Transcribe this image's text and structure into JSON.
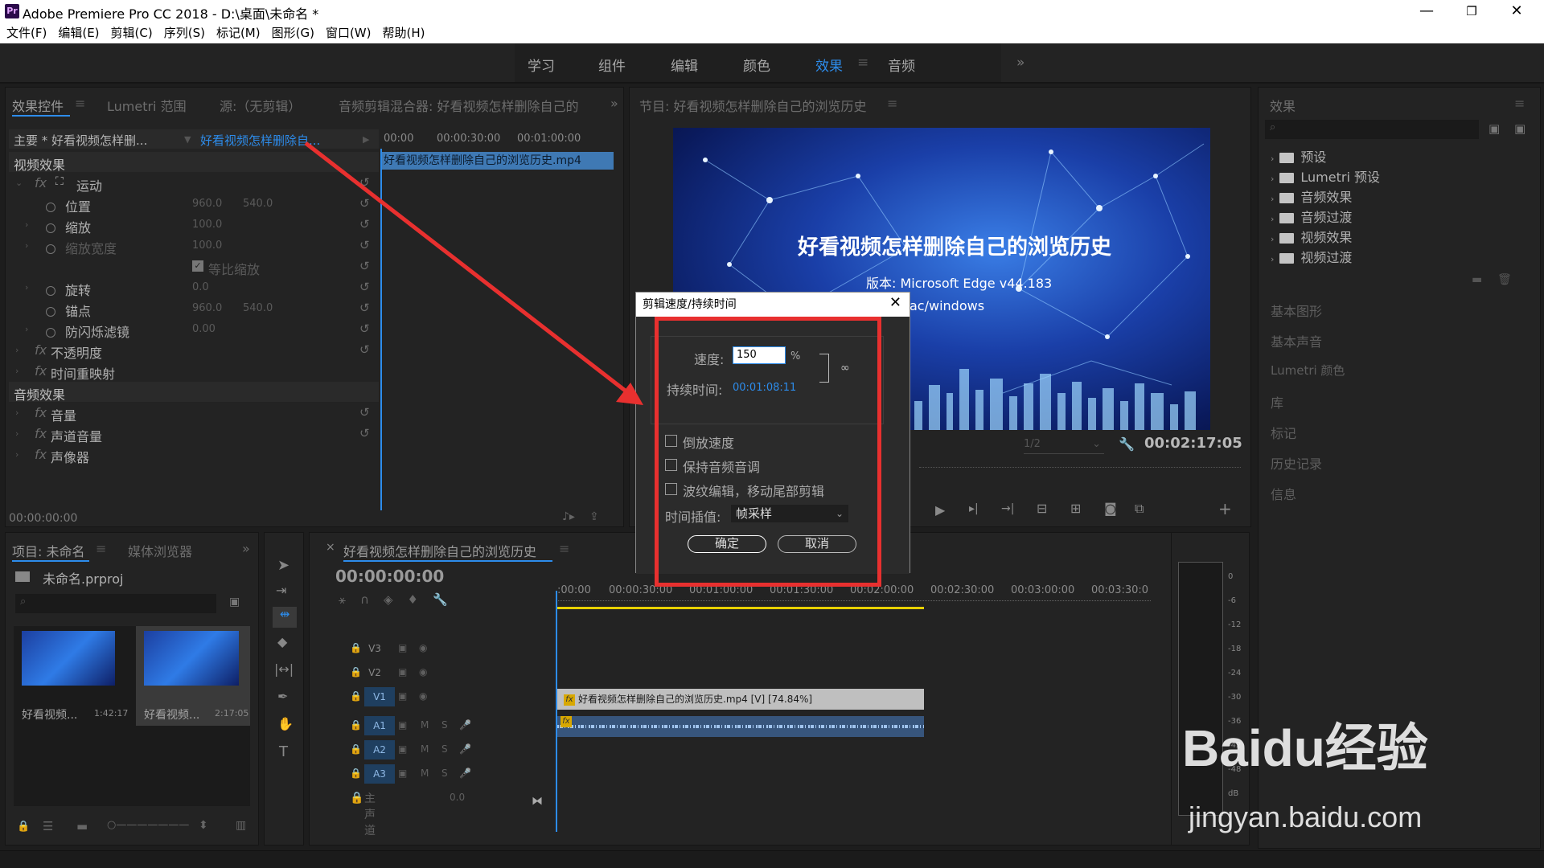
{
  "app": {
    "title": "Adobe Premiere Pro CC 2018 - D:\\桌面\\未命名 *",
    "logo": "Pr",
    "win_min": "—",
    "win_restore": "❐",
    "win_close": "✕"
  },
  "menu": [
    "文件(F)",
    "编辑(E)",
    "剪辑(C)",
    "序列(S)",
    "标记(M)",
    "图形(G)",
    "窗口(W)",
    "帮助(H)"
  ],
  "workspaces": {
    "items": [
      "学习",
      "组件",
      "编辑",
      "颜色",
      "效果",
      "音频"
    ],
    "active": "效果",
    "menu_glyph": "≡",
    "more_glyph": "»"
  },
  "effect_controls": {
    "tabs": [
      "效果控件",
      "Lumetri 范围",
      "源:（无剪辑）",
      "音频剪辑混合器: 好看视频怎样删除自己的"
    ],
    "tab_menu": "≡",
    "more": "»",
    "master_label": "主要 * 好看视频怎样删...",
    "clip_label": "好看视频怎样删除自...",
    "ruler": [
      "00:00",
      "00:00:30:00",
      "00:01:00:00"
    ],
    "clip_bar": "好看视频怎样删除自己的浏览历史.mp4",
    "video_effects": "视频效果",
    "audio_effects": "音频效果",
    "fx": "fx",
    "motion": "运动",
    "position": {
      "label": "位置",
      "x": "960.0",
      "y": "540.0"
    },
    "scale": {
      "label": "缩放",
      "value": "100.0"
    },
    "scale_width": {
      "label": "缩放宽度",
      "value": "100.0"
    },
    "uniform_scale": "等比缩放",
    "rotation": {
      "label": "旋转",
      "value": "0.0"
    },
    "anchor": {
      "label": "锚点",
      "x": "960.0",
      "y": "540.0"
    },
    "anti_flicker": {
      "label": "防闪烁滤镜",
      "value": "0.00"
    },
    "opacity": "不透明度",
    "time_remap": "时间重映射",
    "volume": "音量",
    "channel_volume": "声道音量",
    "panner": "声像器",
    "timecode": "00:00:00:00"
  },
  "program": {
    "title": "节目: 好看视频怎样删除自己的浏览历史",
    "tab_menu": "≡",
    "video_title": "好看视频怎样删除自己的浏览历史",
    "version_line": "版本: Microsoft Edge  v44.183",
    "platform_line": "ac/windows",
    "zoom": "1/2",
    "timecode": "00:02:17:05"
  },
  "effects_panel": {
    "title": "效果",
    "menu": "≡",
    "items": [
      "预设",
      "Lumetri 预设",
      "音频效果",
      "音频过渡",
      "视频效果",
      "视频过渡"
    ],
    "sections": [
      "基本图形",
      "基本声音",
      "Lumetri 颜色",
      "库",
      "标记",
      "历史记录",
      "信息"
    ]
  },
  "dialog": {
    "title": "剪辑速度/持续时间",
    "close": "✕",
    "speed_label": "速度:",
    "speed_value": "150",
    "percent": "%",
    "duration_label": "持续时间:",
    "duration_value": "00:01:08:11",
    "link_glyph": "🔗",
    "reverse": "倒放速度",
    "maintain_pitch": "保持音频音调",
    "ripple": "波纹编辑，移动尾部剪辑",
    "interp_label": "时间插值:",
    "interp_value": "帧采样",
    "ok": "确定",
    "cancel": "取消",
    "colors": {
      "highlight": "#e8302f",
      "link": "#2d8ceb"
    }
  },
  "project": {
    "tabs": [
      "项目: 未命名",
      "媒体浏览器"
    ],
    "tab_menu": "≡",
    "more": "»",
    "file": "未命名.prproj",
    "clips": [
      {
        "name": "好看视频...",
        "duration": "1:42:17"
      },
      {
        "name": "好看视频...",
        "duration": "2:17:05"
      }
    ]
  },
  "timeline": {
    "tab": "好看视频怎样删除自己的浏览历史",
    "close": "×",
    "tab_menu": "≡",
    "timecode": "00:00:00:00",
    "ruler": [
      ":00:00",
      "00:00:30:00",
      "00:01:00:00",
      "00:01:30:00",
      "00:02:00:00",
      "00:02:30:00",
      "00:03:00:00",
      "00:03:30:0"
    ],
    "tracks": [
      "V3",
      "V2",
      "V1",
      "A1",
      "A2",
      "A3"
    ],
    "master": "主声道",
    "master_value": "0.0",
    "video_clip": "好看视频怎样删除自己的浏览历史.mp4 [V] [74.84%]",
    "fx": "fx",
    "mute": "M",
    "solo": "S"
  },
  "meter": {
    "scale": [
      "0",
      "-6",
      "-12",
      "-18",
      "-24",
      "-30",
      "-36",
      "-42",
      "-48",
      "dB"
    ]
  },
  "watermark": {
    "text": "Baidu经验",
    "url": "jingyan.baidu.com"
  }
}
